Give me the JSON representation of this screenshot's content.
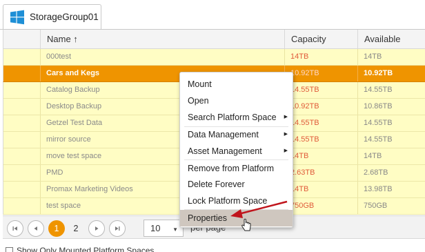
{
  "tab": {
    "label": "StorageGroup01",
    "icon": "windows-logo-icon"
  },
  "grid": {
    "columns": [
      "",
      "Name ↑",
      "Capacity",
      "Available"
    ],
    "rows": [
      {
        "name": "000test",
        "capacity": "14TB",
        "available": "14TB"
      },
      {
        "name": "Cars and Kegs",
        "capacity": "10.92TB",
        "available": "10.92TB",
        "selected": true
      },
      {
        "name": "Catalog Backup",
        "capacity": "14.55TB",
        "available": "14.55TB"
      },
      {
        "name": "Desktop Backup",
        "capacity": "10.92TB",
        "available": "10.86TB"
      },
      {
        "name": "Getzel Test Data",
        "capacity": "14.55TB",
        "available": "14.55TB"
      },
      {
        "name": "mirror source",
        "capacity": "14.55TB",
        "available": "14.55TB"
      },
      {
        "name": "move test space",
        "capacity": "14TB",
        "available": "14TB"
      },
      {
        "name": "PMD",
        "capacity": "2.63TB",
        "available": "2.68TB"
      },
      {
        "name": "Promax Marketing Videos",
        "capacity": "14TB",
        "available": "13.98TB"
      },
      {
        "name": "test space",
        "capacity": "750GB",
        "available": "750GB"
      }
    ]
  },
  "pager": {
    "pages": [
      "1",
      "2"
    ],
    "current_page": "1",
    "page_size": "10",
    "info": "per page"
  },
  "footer": {
    "checkbox_label": "Show Only Mounted Platform Spaces"
  },
  "context_menu": {
    "items": [
      {
        "label": "Mount"
      },
      {
        "label": "Open"
      },
      {
        "label": "Search Platform Space",
        "submenu": true
      },
      {
        "label": "Data Management",
        "submenu": true
      },
      {
        "label": "Asset Management",
        "submenu": true
      },
      {
        "label": "Remove from Platform"
      },
      {
        "label": "Delete Forever"
      },
      {
        "label": "Lock Platform Space"
      },
      {
        "label": "Properties",
        "highlighted": true
      }
    ]
  },
  "colors": {
    "accent": "#ef9400",
    "row_bg": "#fffdc4",
    "capacity_text": "#e05a3a",
    "annotation_arrow": "#c0141c"
  }
}
